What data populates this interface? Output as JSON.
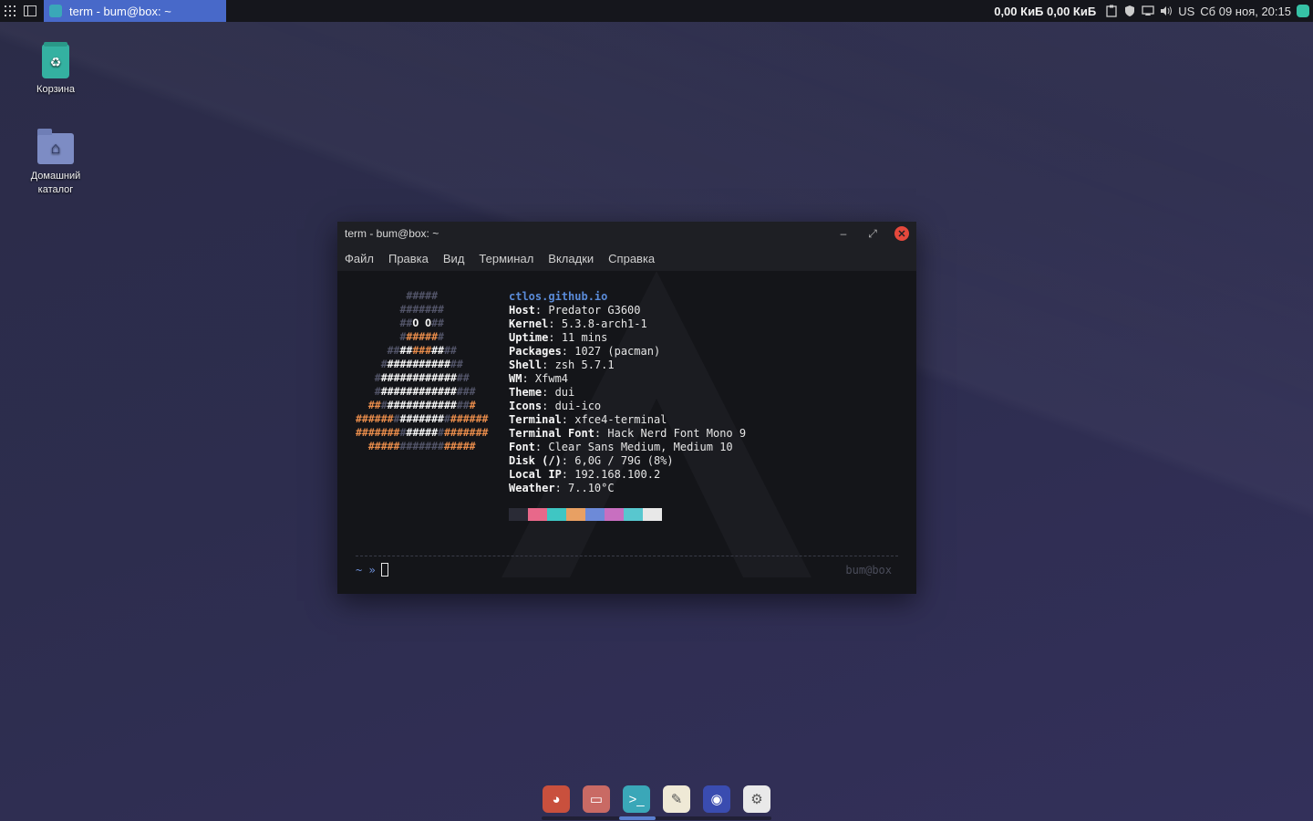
{
  "panel": {
    "task_title": "term - bum@box: ~",
    "net_speed": "0,00 КиБ 0,00 КиБ",
    "layout": "US",
    "datetime": "Сб 09 ноя, 20:15",
    "icons": [
      "apps-grid-icon",
      "window-list-icon",
      "clipboard-icon",
      "shield-icon",
      "display-icon",
      "volume-icon",
      "update-icon"
    ]
  },
  "desktop": {
    "trash_label": "Корзина",
    "home_label": "Домашний каталог"
  },
  "terminal": {
    "title": "term - bum@box: ~",
    "menu": [
      "Файл",
      "Правка",
      "Вид",
      "Терминал",
      "Вкладки",
      "Справка"
    ],
    "logo_lines": [
      [
        [
          "dim",
          "#####"
        ]
      ],
      [
        [
          "dim",
          "#######"
        ]
      ],
      [
        [
          "dim",
          "##"
        ],
        [
          "w",
          "O O"
        ],
        [
          "dim",
          "##"
        ]
      ],
      [
        [
          "dim",
          "#"
        ],
        [
          "o",
          "#####"
        ],
        [
          "dim",
          "#"
        ]
      ],
      [
        [
          "dim",
          "##"
        ],
        [
          "w",
          "##"
        ],
        [
          "o",
          "###"
        ],
        [
          "w",
          "##"
        ],
        [
          "dim",
          "##"
        ]
      ],
      [
        [
          "dim",
          "#"
        ],
        [
          "w",
          "##########"
        ],
        [
          "dim",
          "##"
        ]
      ],
      [
        [
          "dim",
          "#"
        ],
        [
          "w",
          "############"
        ],
        [
          "dim",
          "##"
        ]
      ],
      [
        [
          "dim",
          "#"
        ],
        [
          "w",
          "############"
        ],
        [
          "dim",
          "###"
        ]
      ],
      [
        [
          "o",
          "##"
        ],
        [
          "dim",
          "#"
        ],
        [
          "w",
          "###########"
        ],
        [
          "dim",
          "##"
        ],
        [
          "o",
          "#"
        ]
      ],
      [
        [
          "o",
          "######"
        ],
        [
          "dim",
          "#"
        ],
        [
          "w",
          "#######"
        ],
        [
          "dim",
          "#"
        ],
        [
          "o",
          "######"
        ]
      ],
      [
        [
          "o",
          "#######"
        ],
        [
          "dim",
          "#"
        ],
        [
          "w",
          "#####"
        ],
        [
          "dim",
          "#"
        ],
        [
          "o",
          "#######"
        ]
      ],
      [
        [
          "o",
          "#####"
        ],
        [
          "dim",
          "#######"
        ],
        [
          "o",
          "#####"
        ]
      ]
    ],
    "logo_indent": [
      8,
      7,
      7,
      7,
      5,
      4,
      3,
      3,
      2,
      0,
      0,
      2
    ],
    "header": "ctlos.github.io",
    "info": [
      {
        "key": "Host",
        "value": "Predator G3600"
      },
      {
        "key": "Kernel",
        "value": "5.3.8-arch1-1"
      },
      {
        "key": "Uptime",
        "value": "11 mins"
      },
      {
        "key": "Packages",
        "value": "1027 (pacman)"
      },
      {
        "key": "Shell",
        "value": "zsh 5.7.1"
      },
      {
        "key": "WM",
        "value": "Xfwm4"
      },
      {
        "key": "Theme",
        "value": "dui"
      },
      {
        "key": "Icons",
        "value": "dui-ico"
      },
      {
        "key": "Terminal",
        "value": "xfce4-terminal"
      },
      {
        "key": "Terminal Font",
        "value": "Hack Nerd Font Mono 9"
      },
      {
        "key": "Font",
        "value": "Clear Sans Medium, Medium 10"
      },
      {
        "key": "Disk (/)",
        "value": "6,0G / 79G (8%)"
      },
      {
        "key": "Local IP",
        "value": "192.168.100.2"
      },
      {
        "key": "Weather",
        "value": "7..10°C"
      }
    ],
    "palette": [
      "#2a2b36",
      "#e8688a",
      "#3fc6c3",
      "#e8a063",
      "#6d8ad8",
      "#c86fc0",
      "#58c7cf",
      "#e8e8e8"
    ],
    "prompt": "~ »",
    "right_prompt": "bum@box"
  },
  "dock": {
    "items": [
      {
        "name": "dock-browser-chromium",
        "color": "#c9503d",
        "glyph": "◕"
      },
      {
        "name": "dock-file-manager",
        "color": "#c96a64",
        "glyph": "▭"
      },
      {
        "name": "dock-terminal",
        "color": "#3aa7b8",
        "glyph": ">_"
      },
      {
        "name": "dock-text-editor",
        "color": "#efe9d6",
        "glyph": "✎"
      },
      {
        "name": "dock-firefox",
        "color": "#3a4cb0",
        "glyph": "◉"
      },
      {
        "name": "dock-settings",
        "color": "#e9e9e9",
        "glyph": "⚙"
      }
    ]
  }
}
